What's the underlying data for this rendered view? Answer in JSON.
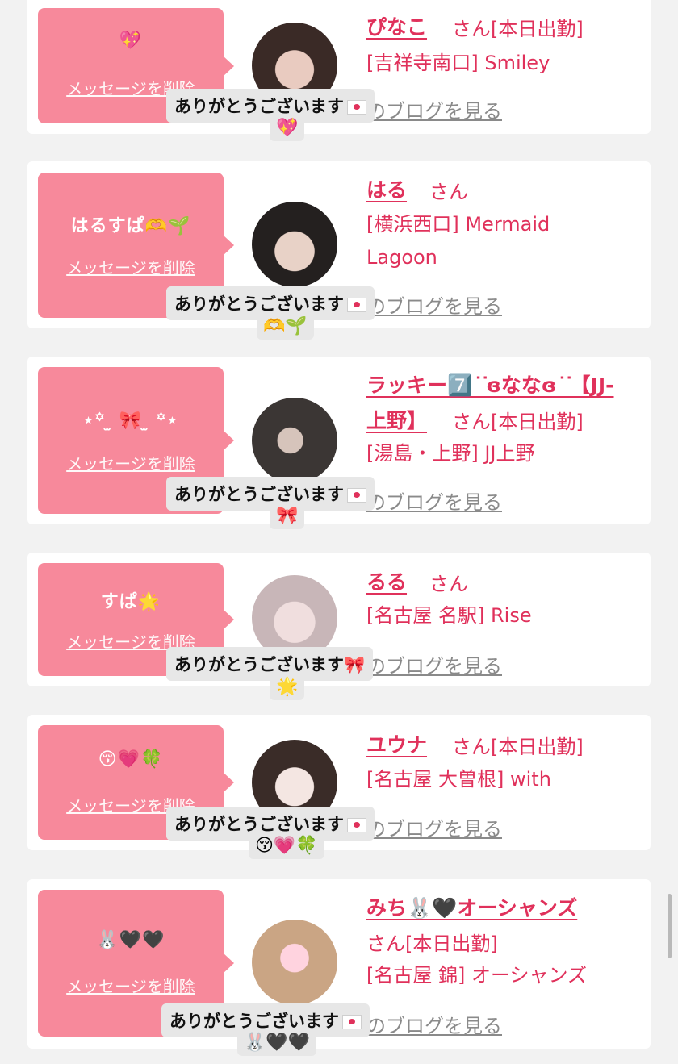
{
  "common": {
    "delete_label": "メッセージを削除",
    "blog_label": "のブログを見る",
    "thanks_label": "ありがとうございます"
  },
  "entries": [
    {
      "bubble_text": "💖",
      "name": "ぴなこ",
      "san": "さん[本日出勤]",
      "shop": "[吉祥寺南口] Smiley",
      "shop2": "",
      "tooltip_emoji": "💖"
    },
    {
      "bubble_text": "はるすぱ🫶🌱",
      "name": "はる",
      "san": "さん",
      "shop": "[横浜西口] Mermaid",
      "shop2": "Lagoon",
      "tooltip_emoji": "🫶🌱"
    },
    {
      "bubble_text": "⋆꙳ ̫ 🎀 ̫ ꙳⋆",
      "name": "ラッキー7️⃣ ͘ ͘ɞななɞ ͘ ͘【JJ-",
      "name2": "上野】",
      "san": "さん[本日出勤]",
      "shop": "[湯島・上野] JJ上野",
      "shop2": "",
      "tooltip_emoji": "🎀"
    },
    {
      "bubble_text": "すぱ🌟",
      "name": "るる",
      "san": "さん",
      "shop": "[名古屋 名駅] Rise",
      "shop2": "",
      "tooltip_emoji": "🌟"
    },
    {
      "bubble_text": "😚💗🍀",
      "name": "ユウナ",
      "san": "さん[本日出勤]",
      "shop": "[名古屋 大曽根] with",
      "shop2": "",
      "tooltip_emoji": "😚💗🍀"
    },
    {
      "bubble_text": "🐰🖤🖤",
      "name": "みち🐰🖤オーシャンズ",
      "san": "さん[本日出勤]",
      "shop": "[名古屋 錦] オーシャンズ",
      "shop2": "",
      "tooltip_emoji": "🐰🖤🖤"
    }
  ],
  "colors": {
    "accent": "#e0315b",
    "bubble": "#f7899b",
    "background": "#f2f2f2"
  }
}
